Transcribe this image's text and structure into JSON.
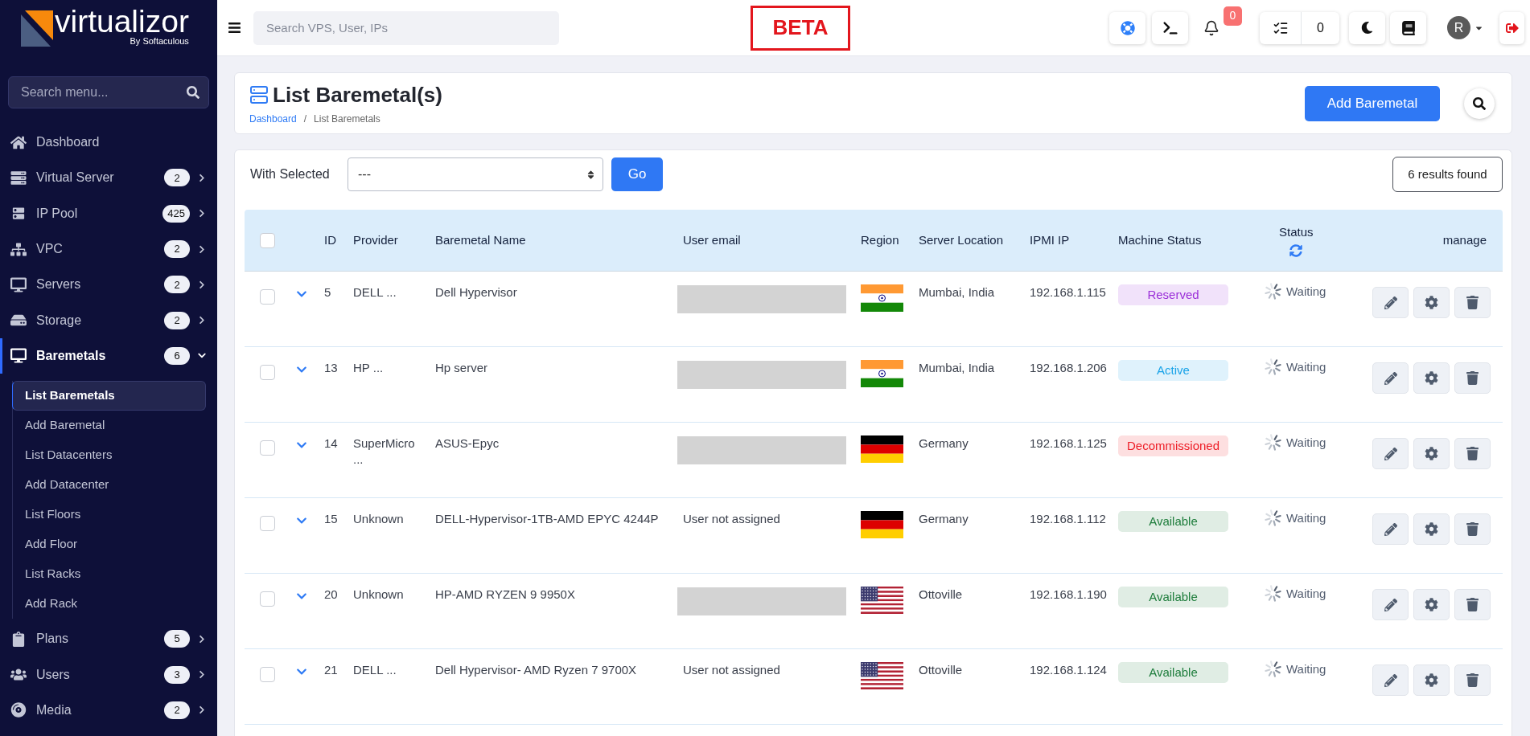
{
  "logo": {
    "name": "virtualizor",
    "tagline": "By Softaculous"
  },
  "sidebar": {
    "search": {
      "placeholder": "Search menu..."
    },
    "items": [
      {
        "kind": "link",
        "label": "Dashboard",
        "selected": false
      },
      {
        "kind": "group",
        "label": "Virtual Server",
        "count": "2",
        "selected": false,
        "expanded": false
      },
      {
        "kind": "group",
        "label": "IP Pool",
        "count": "425",
        "selected": false,
        "expanded": false
      },
      {
        "kind": "group",
        "label": "VPC",
        "count": "2",
        "selected": false,
        "expanded": false
      },
      {
        "kind": "group",
        "label": "Servers",
        "count": "2",
        "selected": false,
        "expanded": false
      },
      {
        "kind": "group",
        "label": "Storage",
        "count": "2",
        "selected": false,
        "expanded": false
      },
      {
        "kind": "group",
        "label": "Baremetals",
        "count": "6",
        "selected": true,
        "expanded": true,
        "children": [
          {
            "label": "List Baremetals",
            "selected": true
          },
          {
            "label": "Add Baremetal",
            "selected": false
          },
          {
            "label": "List Datacenters",
            "selected": false
          },
          {
            "label": "Add Datacenter",
            "selected": false
          },
          {
            "label": "List Floors",
            "selected": false
          },
          {
            "label": "Add Floor",
            "selected": false
          },
          {
            "label": "List Racks",
            "selected": false
          },
          {
            "label": "Add Rack",
            "selected": false
          }
        ]
      },
      {
        "kind": "group",
        "label": "Plans",
        "count": "5",
        "selected": false,
        "expanded": false
      },
      {
        "kind": "group",
        "label": "Users",
        "count": "3",
        "selected": false,
        "expanded": false
      },
      {
        "kind": "group",
        "label": "Media",
        "count": "2",
        "selected": false,
        "expanded": false
      }
    ]
  },
  "topbar": {
    "search": {
      "placeholder": "Search VPS, User, IPs"
    },
    "beta_label": "BETA",
    "notification_count": "0",
    "task_count": "0",
    "avatar_initial": "R"
  },
  "page_header": {
    "title": "List Baremetal(s)",
    "breadcrumb": {
      "items": [
        {
          "kind": "link",
          "label": "Dashboard"
        },
        {
          "kind": "current",
          "label": "List Baremetals"
        }
      ],
      "separator": "/"
    },
    "add_button": "Add Baremetal"
  },
  "toolbar": {
    "label": "With Selected",
    "select": {
      "value": "---"
    },
    "go_button": "Go",
    "results": "6 results found"
  },
  "table": {
    "select_all": {
      "checked": false
    },
    "columns": [
      "ID",
      "Provider",
      "Baremetal Name",
      "User email",
      "Region",
      "Server Location",
      "IPMI IP",
      "Machine Status",
      "Status",
      "manage"
    ],
    "rows": [
      {
        "checked": false,
        "id": "5",
        "provider": "DELL ...",
        "name": "Dell Hypervisor",
        "user_email": {
          "kind": "redacted"
        },
        "region": {
          "kind": "india"
        },
        "location": "Mumbai, India",
        "ipmi_ip": "192.168.1.115",
        "machine_status": {
          "label": "Reserved",
          "color": "#9b30d9"
        },
        "status": "Waiting"
      },
      {
        "checked": false,
        "id": "13",
        "provider": "HP ...",
        "name": "Hp server",
        "user_email": {
          "kind": "redacted"
        },
        "region": {
          "kind": "india"
        },
        "location": "Mumbai, India",
        "ipmi_ip": "192.168.1.206",
        "machine_status": {
          "label": "Active",
          "color": "#1aa3e8"
        },
        "status": "Waiting"
      },
      {
        "checked": false,
        "id": "14",
        "provider": "SuperMicro ...",
        "name": "ASUS-Epyc",
        "user_email": {
          "kind": "redacted"
        },
        "region": {
          "kind": "germany"
        },
        "location": "Germany",
        "ipmi_ip": "192.168.1.125",
        "machine_status": {
          "label": "Decommissioned",
          "color": "#ee1c25"
        },
        "status": "Waiting"
      },
      {
        "checked": false,
        "id": "15",
        "provider": "Unknown",
        "name": "DELL-Hypervisor-1TB-AMD EPYC 4244P",
        "user_email": {
          "kind": "text",
          "text": "User not assigned"
        },
        "region": {
          "kind": "germany"
        },
        "location": "Germany",
        "ipmi_ip": "192.168.1.112",
        "machine_status": {
          "label": "Available",
          "color": "#1e7d3c"
        },
        "status": "Waiting"
      },
      {
        "checked": false,
        "id": "20",
        "provider": "Unknown",
        "name": "HP-AMD RYZEN 9 9950X",
        "user_email": {
          "kind": "redacted"
        },
        "region": {
          "kind": "usa"
        },
        "location": "Ottoville",
        "ipmi_ip": "192.168.1.190",
        "machine_status": {
          "label": "Available",
          "color": "#1e7d3c"
        },
        "status": "Waiting"
      },
      {
        "checked": false,
        "id": "21",
        "provider": "DELL ...",
        "name": "Dell Hypervisor- AMD Ryzen 7 9700X",
        "user_email": {
          "kind": "text",
          "text": "User not assigned"
        },
        "region": {
          "kind": "usa"
        },
        "location": "Ottoville",
        "ipmi_ip": "192.168.1.124",
        "machine_status": {
          "label": "Available",
          "color": "#1e7d3c"
        },
        "status": "Waiting"
      }
    ]
  }
}
